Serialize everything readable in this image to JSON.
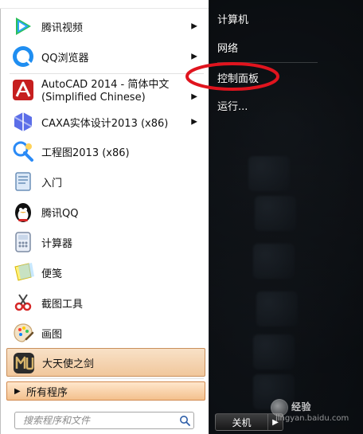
{
  "start_menu": {
    "left_items": [
      {
        "label": "腾讯视频",
        "icon": "tencent-video-icon",
        "has_submenu": true
      },
      {
        "label": "QQ浏览器",
        "icon": "qq-browser-icon",
        "has_submenu": true
      },
      {
        "label_line1": "AutoCAD 2014 - 简体中文",
        "label_line2": "(Simplified Chinese)",
        "icon": "autocad-icon",
        "has_submenu": true
      },
      {
        "label": "CAXA实体设计2013 (x86)",
        "icon": "caxa-icon",
        "has_submenu": true
      },
      {
        "label": "工程图2013 (x86)",
        "icon": "engineering-drawing-icon",
        "has_submenu": false
      },
      {
        "label": "入门",
        "icon": "getting-started-icon",
        "has_submenu": false
      },
      {
        "label": "腾讯QQ",
        "icon": "qq-penguin-icon",
        "has_submenu": false
      },
      {
        "label": "计算器",
        "icon": "calculator-icon",
        "has_submenu": false
      },
      {
        "label": "便笺",
        "icon": "sticky-notes-icon",
        "has_submenu": false
      },
      {
        "label": "截图工具",
        "icon": "snipping-tool-icon",
        "has_submenu": false
      },
      {
        "label": "画图",
        "icon": "paint-icon",
        "has_submenu": false
      },
      {
        "label": "大天使之剑",
        "icon": "game-mu-icon",
        "has_submenu": false
      }
    ],
    "all_programs": "所有程序",
    "search": {
      "placeholder": "搜索程序和文件",
      "icon": "search-icon"
    },
    "right_items": [
      {
        "label": "计算机"
      },
      {
        "label": "网络"
      },
      {
        "label": "控制面板"
      },
      {
        "label": "运行..."
      }
    ],
    "shutdown_label": "关机"
  },
  "watermark": {
    "brand": "经验",
    "site": "jingyan.baidu.com"
  },
  "colors": {
    "active_orange": "#F1C79C",
    "active_border": "#C98F5B",
    "annotation_red": "#E0141E"
  }
}
